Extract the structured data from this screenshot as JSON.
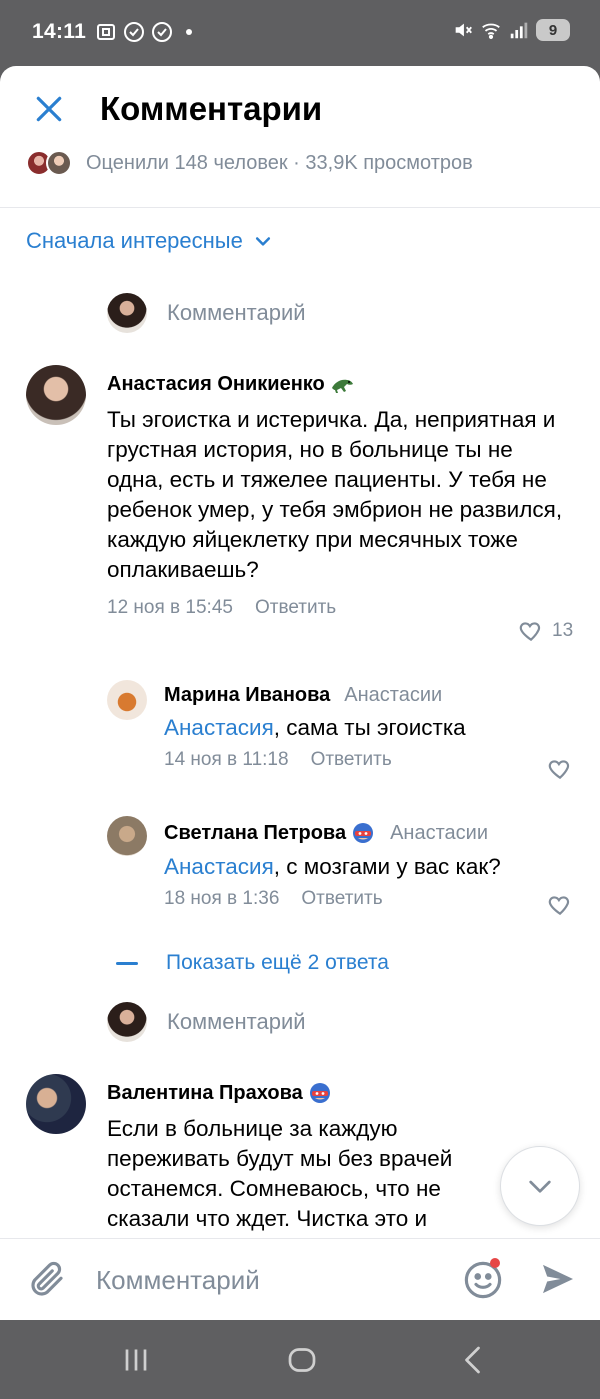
{
  "status_bar": {
    "time": "14:11",
    "battery": "9"
  },
  "header": {
    "title": "Комментарии",
    "stats": "Оценили 148 человек · 33,9K просмотров"
  },
  "sort": {
    "label": "Сначала интересные"
  },
  "comment_placeholder": "Комментарий",
  "comments": [
    {
      "author": "Анастасия Оникиенко",
      "text": "Ты эгоистка и истеричка. Да, неприятная и грустная история, но в больнице ты не одна, есть и тяжелее пациенты. У тебя не ребенок умер, у тебя эмбрион не развился, каждую яйцеклетку при месячных тоже оплакиваешь?",
      "date": "12 ноя в 15:45",
      "reply_label": "Ответить",
      "likes": "13",
      "replies": [
        {
          "author": "Марина Иванова",
          "reply_to": "Анастасии",
          "mention": "Анастасия",
          "text": ", сама ты эгоистка",
          "date": "14 ноя в 11:18",
          "reply_label": "Ответить"
        },
        {
          "author": "Светлана Петрова",
          "reply_to": "Анастасии",
          "mention": "Анастасия",
          "text": ", с  мозгами у вас как?",
          "date": "18 ноя в 1:36",
          "reply_label": "Ответить"
        }
      ],
      "show_more": "Показать ещё 2 ответа"
    },
    {
      "author": "Валентина Прахова",
      "text_lines": [
        "Если в больнице за каждую",
        "переживать будут мы без врачей",
        "останемся. Сомневаюсь, что не",
        "сказали что ждет. Чистка это и"
      ]
    }
  ],
  "composer": {
    "placeholder": "Комментарий"
  },
  "colors": {
    "accent": "#2a7fd0",
    "secondary_text": "#818c99",
    "system_bar": "#5f5f61"
  }
}
